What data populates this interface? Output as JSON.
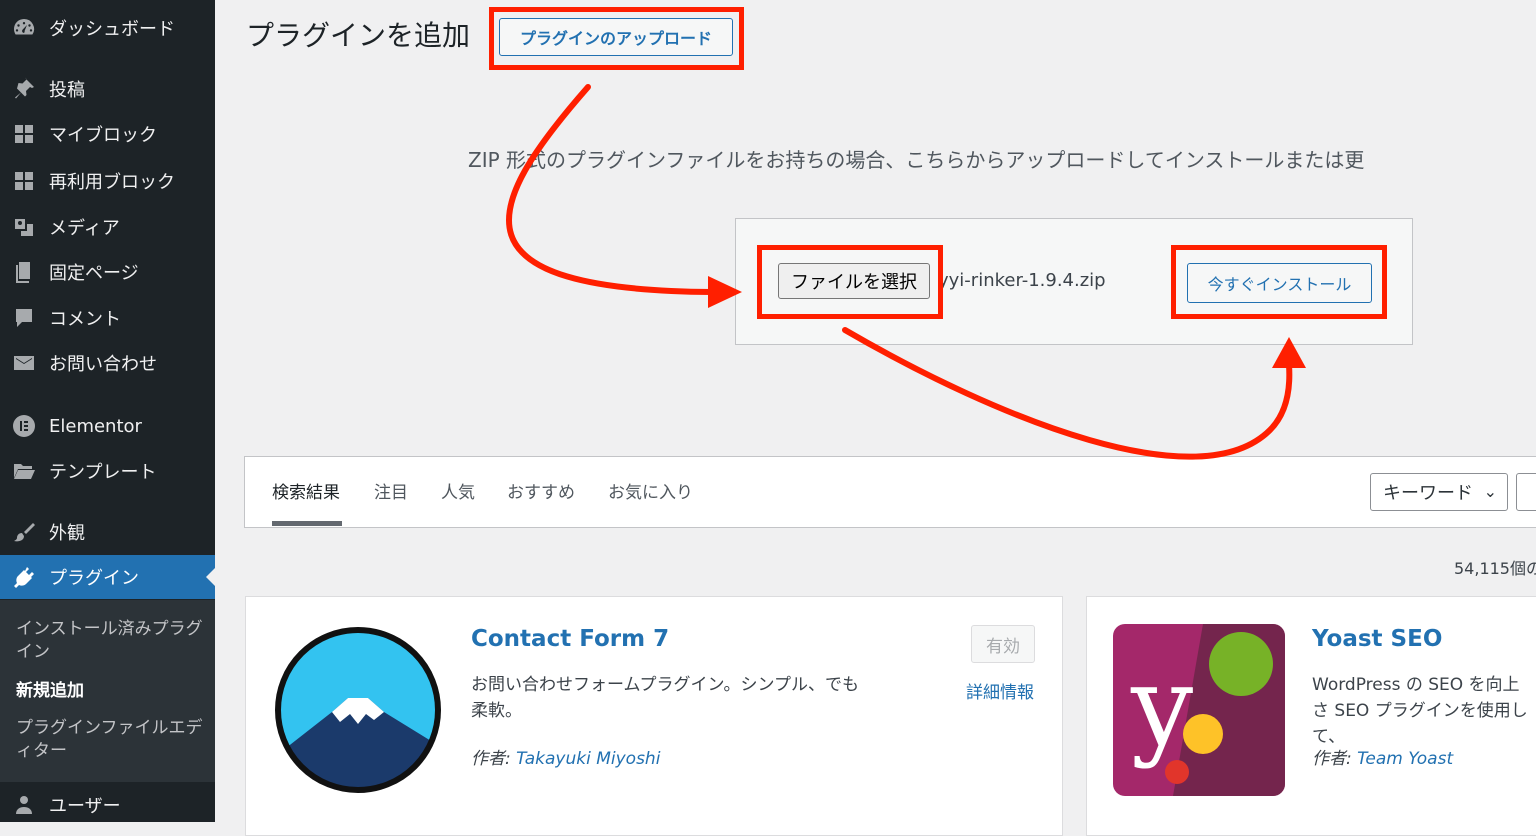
{
  "sidebar": {
    "items": [
      {
        "label": "ダッシュボード",
        "icon": "dashboard-icon"
      },
      {
        "label": "投稿",
        "icon": "pin-icon"
      },
      {
        "label": "マイブロック",
        "icon": "grid-icon"
      },
      {
        "label": "再利用ブロック",
        "icon": "grid-icon"
      },
      {
        "label": "メディア",
        "icon": "media-icon"
      },
      {
        "label": "固定ページ",
        "icon": "page-icon"
      },
      {
        "label": "コメント",
        "icon": "comment-icon"
      },
      {
        "label": "お問い合わせ",
        "icon": "mail-icon"
      },
      {
        "label": "Elementor",
        "icon": "elementor-icon"
      },
      {
        "label": "テンプレート",
        "icon": "folder-icon"
      },
      {
        "label": "外観",
        "icon": "brush-icon"
      },
      {
        "label": "プラグイン",
        "icon": "plugin-icon",
        "active": true
      },
      {
        "label": "ユーザー",
        "icon": "user-icon"
      }
    ],
    "submenu": [
      {
        "label": "インストール済みプラグイン"
      },
      {
        "label": "新規追加",
        "current": true
      },
      {
        "label": "プラグインファイルエディター"
      }
    ]
  },
  "header": {
    "title": "プラグインを追加",
    "upload_button": "プラグインのアップロード"
  },
  "upload": {
    "description": "ZIP 形式のプラグインファイルをお持ちの場合、こちらからアップロードしてインストールまたは更",
    "file_button": "ファイルを選択",
    "file_name": "yyi-rinker-1.9.4.zip",
    "install_button": "今すぐインストール"
  },
  "filter": {
    "tabs": [
      "検索結果",
      "注目",
      "人気",
      "おすすめ",
      "お気に入り"
    ],
    "select_value": "キーワード",
    "count": "54,115個の"
  },
  "plugins": [
    {
      "name": "Contact Form 7",
      "description": "お問い合わせフォームプラグイン。シンプル、でも柔軟。",
      "author_prefix": "作者: ",
      "author": "Takayuki Miyoshi",
      "action": "有効",
      "more": "詳細情報"
    },
    {
      "name": "Yoast SEO",
      "description": "WordPress の SEO を向上さ SEO プラグインを使用して、",
      "author_prefix": "作者: ",
      "author": "Team Yoast"
    }
  ],
  "colors": {
    "sidebar_bg": "#1d2327",
    "accent": "#2271b1",
    "annotation": "#ff1f00"
  }
}
